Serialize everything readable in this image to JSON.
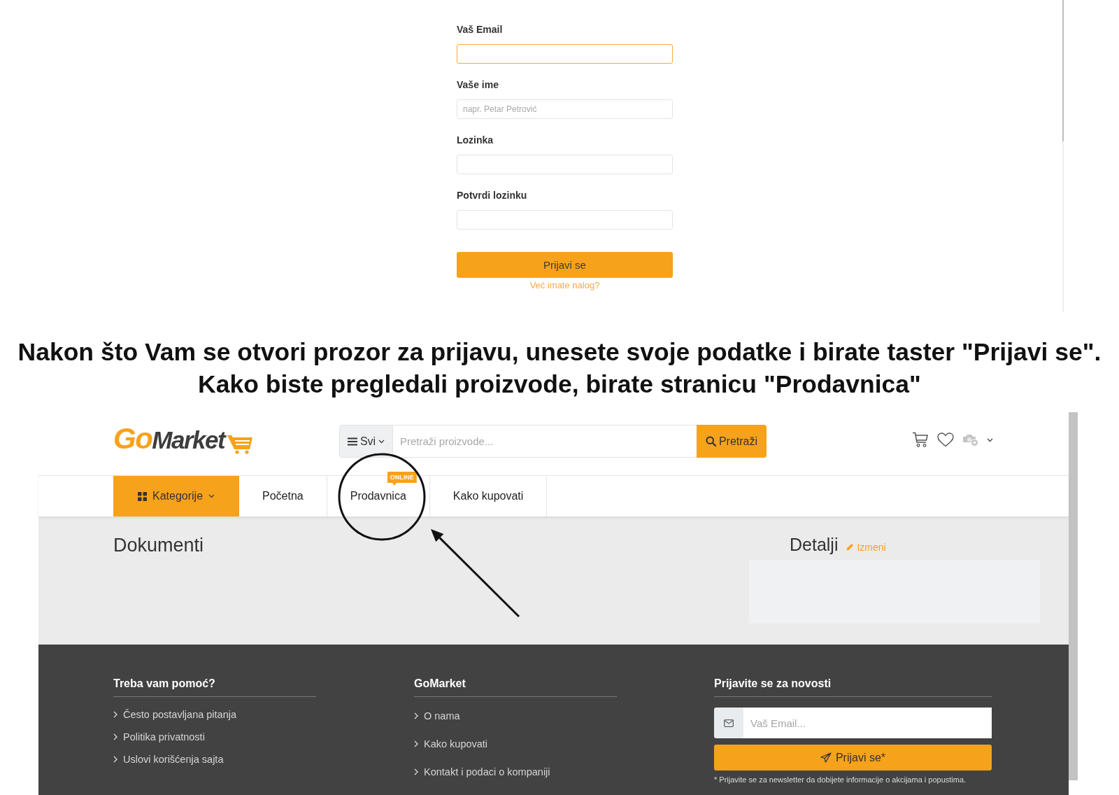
{
  "registration_form": {
    "fields": [
      {
        "label": "Vaš Email",
        "focused": true
      },
      {
        "label": "Vaše ime",
        "placeholder": "napr. Petar Petrović",
        "focused": false
      },
      {
        "label": "Lozinka",
        "focused": false
      },
      {
        "label": "Potvrdi lozinku",
        "focused": false
      }
    ],
    "submit_button": "Prijavi se",
    "login_link": "Već imate nalog?"
  },
  "caption": {
    "lines": [
      "Nakon što Vam se otvori prozor za prijavu, unesete svoje podatke i birate taster \"Prijavi se\".",
      "Kako biste pregledali proizvode, birate stranicu \"Prodavnica\""
    ]
  },
  "shop": {
    "logo": {
      "parts": [
        "Go",
        "Market"
      ]
    },
    "search": {
      "category": "Svi",
      "placeholder": "Pretraži proizvode...",
      "button": "Pretraži"
    },
    "nav": [
      {
        "label": "Kategorije",
        "kind": "categories"
      },
      {
        "label": "Početna",
        "kind": "link"
      },
      {
        "label": "Prodavnica",
        "kind": "link",
        "badge": "ONLINE"
      },
      {
        "label": "Kako kupovati",
        "kind": "link"
      }
    ],
    "page_title": "Dokumenti",
    "details": {
      "title": "Detalji",
      "edit_link": "Izmeni"
    },
    "footer": {
      "columns": [
        {
          "title": "Treba vam pomoć?",
          "links": [
            "Često postavljana pitanja",
            "Politika privatnosti",
            "Uslovi korišćenja sajta"
          ]
        },
        {
          "title": "GoMarket",
          "links": [
            "O nama",
            "Kako kupovati",
            "Kontakt i podaci o kompaniji"
          ]
        }
      ],
      "newsletter": {
        "title": "Prijavite se za novosti",
        "placeholder": "Vaš Email...",
        "button": "Prijavi se*",
        "note": "* Prijavite se za newsletter da dobijete informacije o akcijama i popustima."
      }
    }
  }
}
